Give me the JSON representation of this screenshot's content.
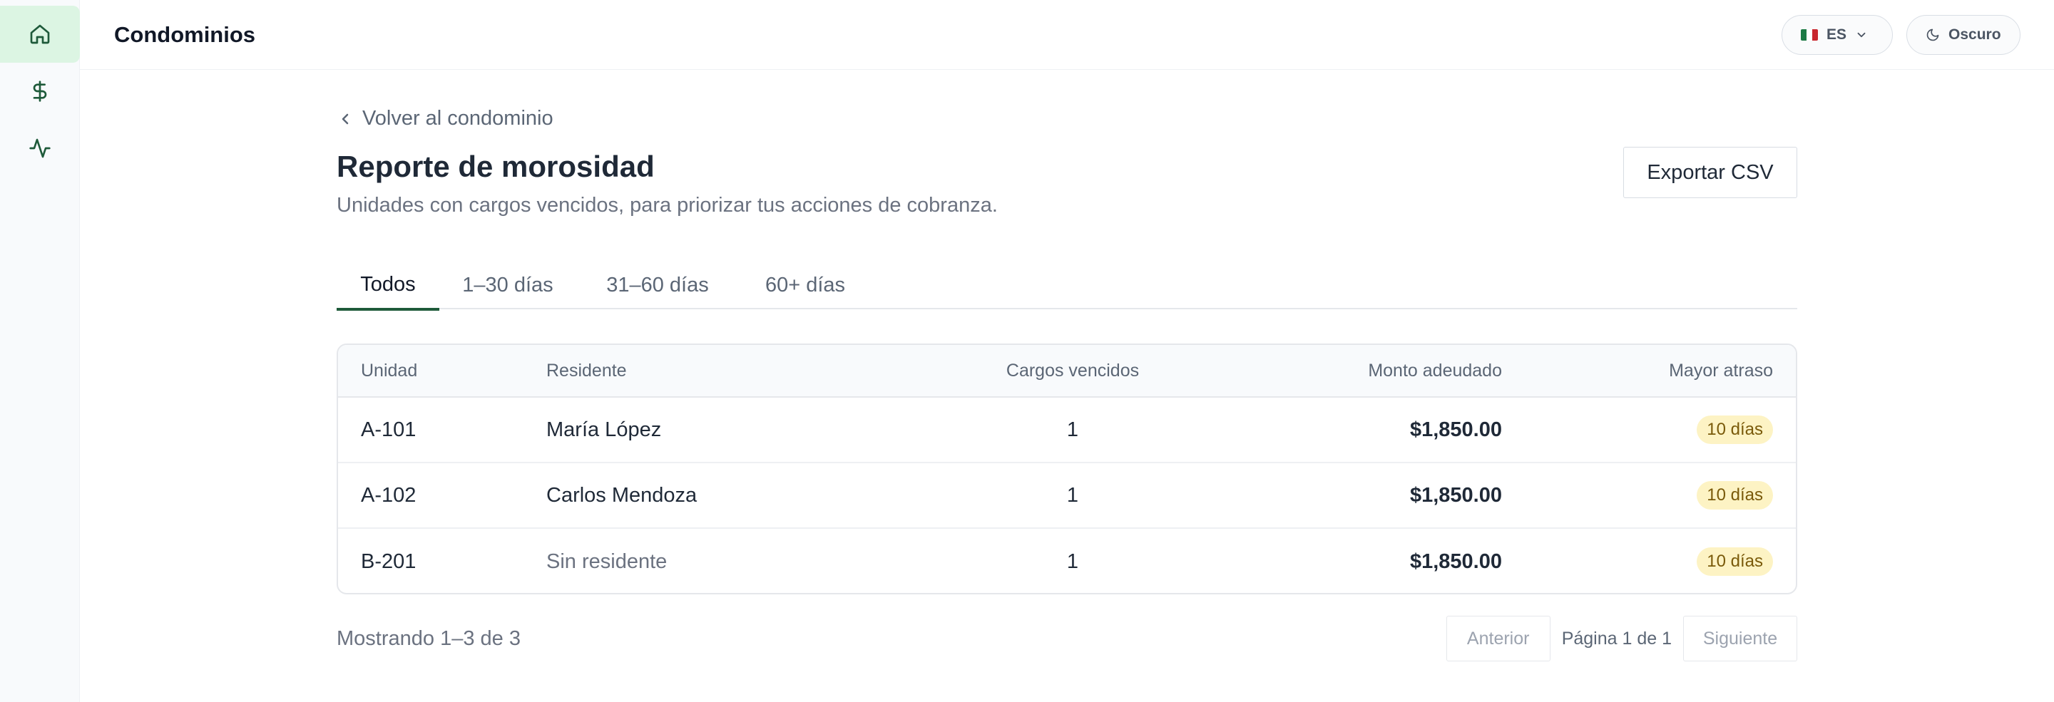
{
  "app": {
    "title": "Condominios"
  },
  "sidebar": {
    "items": [
      {
        "icon": "home-icon",
        "active": true
      },
      {
        "icon": "dollar-icon",
        "active": false
      },
      {
        "icon": "activity-icon",
        "active": false
      }
    ]
  },
  "topbar": {
    "language": {
      "code": "ES",
      "flag": "mexico-flag-icon"
    },
    "theme_label": "Oscuro"
  },
  "page": {
    "back_label": "Volver al condominio",
    "title": "Reporte de morosidad",
    "subtitle": "Unidades con cargos vencidos, para priorizar tus acciones de cobranza.",
    "export_label": "Exportar CSV"
  },
  "tabs": [
    {
      "label": "Todos",
      "active": true
    },
    {
      "label": "1–30 días",
      "active": false
    },
    {
      "label": "31–60 días",
      "active": false
    },
    {
      "label": "60+ días",
      "active": false
    }
  ],
  "table": {
    "headers": {
      "unit": "Unidad",
      "resident": "Residente",
      "count": "Cargos vencidos",
      "amount": "Monto adeudado",
      "delay": "Mayor atraso"
    },
    "rows": [
      {
        "unit": "A-101",
        "resident": "María López",
        "count": "1",
        "amount": "$1,850.00",
        "delay": "10 días"
      },
      {
        "unit": "A-102",
        "resident": "Carlos Mendoza",
        "count": "1",
        "amount": "$1,850.00",
        "delay": "10 días"
      },
      {
        "unit": "B-201",
        "resident": "Sin residente",
        "count": "1",
        "amount": "$1,850.00",
        "delay": "10 días"
      }
    ]
  },
  "footer": {
    "showing": "Mostrando 1–3 de 3",
    "prev_label": "Anterior",
    "page_info": "Página 1 de 1",
    "next_label": "Siguiente"
  },
  "colors": {
    "accent": "#1e5a3a",
    "sidebar_active_bg": "#dcf5e3",
    "badge_bg": "#fdf3c4",
    "badge_text": "#7a5a0a"
  }
}
